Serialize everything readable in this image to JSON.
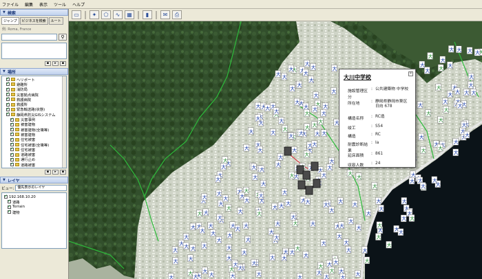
{
  "menu": [
    "ファイル",
    "編集",
    "表示",
    "ツール",
    "ヘルプ"
  ],
  "search_panel": {
    "title": "検索",
    "tabs": [
      "ジャンプ",
      "ビジネスを検索",
      "ルート"
    ],
    "example": "例: Roma, France",
    "search_label": "⚲"
  },
  "places_panel": {
    "title": "場所",
    "items": [
      "ヘリポート",
      "避難所",
      "消防局",
      "災害拠点病院",
      "救護病院",
      "救護所",
      "緊急輸送路(状態)",
      "静岡県防災GISシステム",
      "災害事例",
      "被害建物",
      "被害建物(全壊等)",
      "被害建物",
      "住宅被害",
      "住宅被害(全壊等)",
      "住宅被害",
      "道路被害",
      "通行止め",
      "道路被害",
      "土砂災害警戒区域",
      "緊急輸送路ルート"
    ]
  },
  "layers_panel": {
    "title": "レイヤ",
    "view_label": "ビュー:",
    "view_value": "優先表示のレイヤ",
    "items": [
      "192.168.10.20",
      "道路",
      "Terrain",
      "建物"
    ]
  },
  "popup": {
    "title": "大川中学校",
    "close": "×",
    "rows": [
      {
        "k": "施設管理区分",
        "v": "公共建築物 中学校"
      },
      {
        "k": "所在地",
        "v": "静岡県静岡市葵区日向 678"
      },
      {
        "k": "構造名称",
        "v": "RC造"
      },
      {
        "k": "竣工",
        "v": "S54"
      },
      {
        "k": "構造",
        "v": "RC"
      },
      {
        "k": "耐震診断結果",
        "v": "Ⅰa"
      },
      {
        "k": "延床面積",
        "v": "861"
      },
      {
        "k": "収容人数",
        "v": "24"
      }
    ]
  }
}
